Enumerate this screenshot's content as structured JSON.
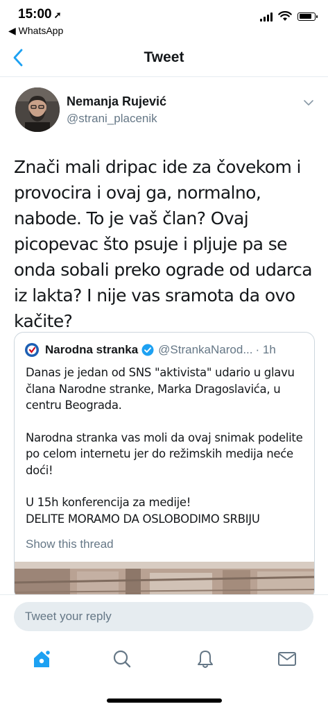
{
  "status_bar": {
    "time": "15:00",
    "location_arrow": "➚",
    "back_app_label": "◀ WhatsApp",
    "icons": [
      "cellular-signal-icon",
      "wifi-icon",
      "battery-icon"
    ],
    "battery_level": 0.85
  },
  "nav": {
    "title": "Tweet",
    "back_icon": "chevron-left-icon"
  },
  "tweet": {
    "author_name": "Nemanja Rujević",
    "author_handle": "@strani_placenik",
    "text": "Znači mali dripac ide za čovekom i provocira i ovaj ga, normalno, nabode. To je vaš član? Ovaj picopevac što psuje i pljuje pa se onda sobali preko ograde od udarca iz lakta? I nije vas sramota da ovo kačite?"
  },
  "quote": {
    "name": "Narodna stranka",
    "handle": "@StrankaNarod...",
    "time": "· 1h",
    "paragraphs": [
      "Danas je jedan od SNS \"aktivista\" udario u glavu člana Narodne stranke, Marka Dragoslavića, u centru Beograda.",
      "Narodna stranka vas moli da ovaj snimak podelite po celom internetu jer do režimskih medija neće doći!",
      "U 15h konferencija za medije!",
      "DELITE MORAMO DA OSLOBODIMO SRBIJU"
    ],
    "show_thread": "Show this thread"
  },
  "reply": {
    "placeholder": "Tweet your reply"
  },
  "tabbar": {
    "tabs": [
      "home-icon",
      "search-icon",
      "notifications-icon",
      "messages-icon"
    ]
  },
  "colors": {
    "accent": "#1da1f2",
    "text": "#14171a",
    "secondary": "#657786",
    "border": "#ccd6dd",
    "input_bg": "#e6ecf0"
  }
}
